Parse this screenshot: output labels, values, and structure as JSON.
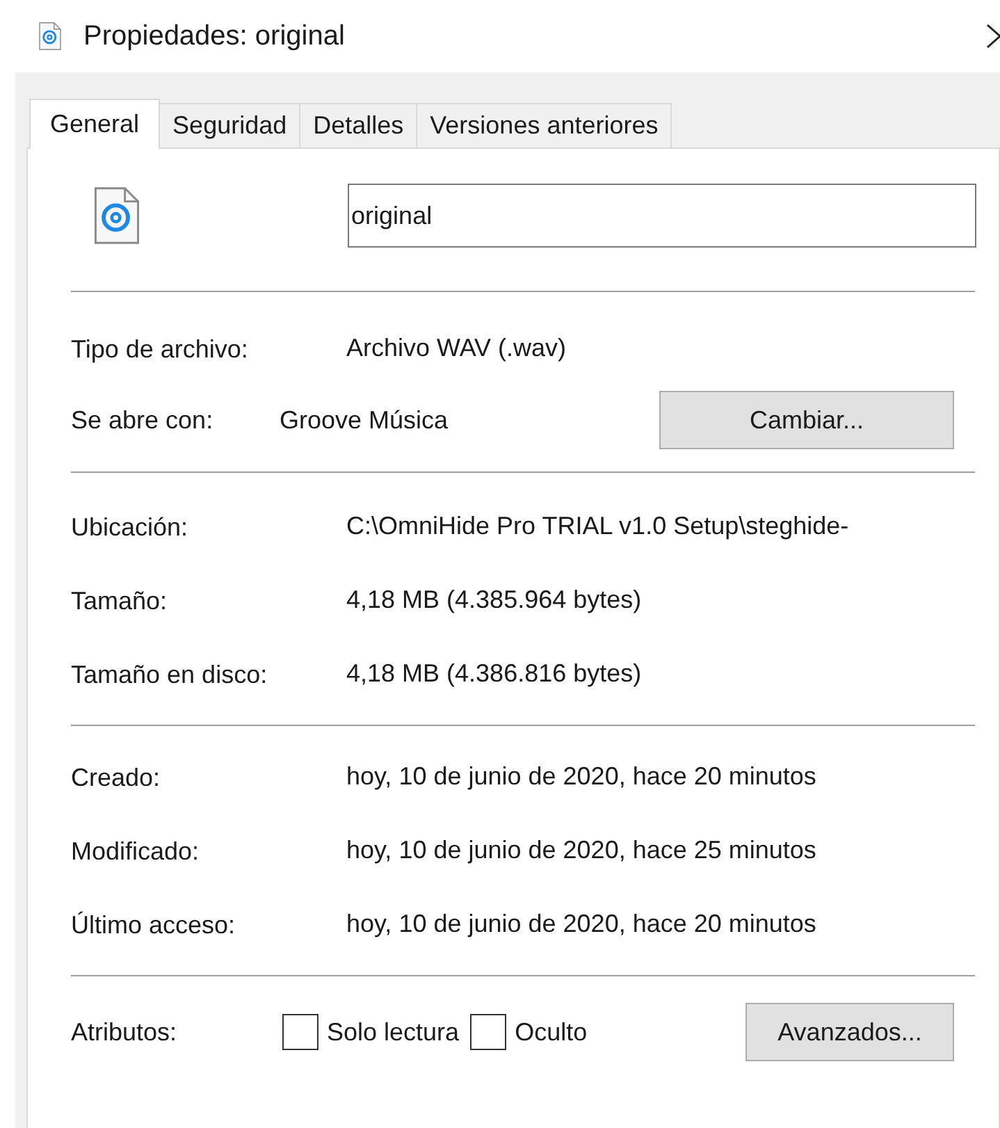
{
  "window": {
    "title": "Propiedades: original"
  },
  "tabs": [
    {
      "label": "General",
      "selected": true
    },
    {
      "label": "Seguridad",
      "selected": false
    },
    {
      "label": "Detalles",
      "selected": false
    },
    {
      "label": "Versiones anteriores",
      "selected": false
    }
  ],
  "name_field": {
    "value": "original"
  },
  "type_row": {
    "label": "Tipo de archivo:",
    "value": "Archivo WAV (.wav)"
  },
  "opens_with": {
    "label": "Se abre con:",
    "value": "Groove Música",
    "button": "Cambiar..."
  },
  "location_rows": [
    {
      "label": "Ubicación:",
      "value": "C:\\OmniHide Pro TRIAL v1.0 Setup\\steghide-"
    },
    {
      "label": "Tamaño:",
      "value": "4,18 MB (4.385.964 bytes)"
    },
    {
      "label": "Tamaño en disco:",
      "value": "4,18 MB (4.386.816 bytes)"
    }
  ],
  "date_rows": [
    {
      "label": "Creado:",
      "value": "hoy, 10 de junio de 2020, hace 20 minutos"
    },
    {
      "label": "Modificado:",
      "value": "hoy, 10 de junio de 2020, hace 25 minutos"
    },
    {
      "label": "Último acceso:",
      "value": "hoy, 10 de junio de 2020, hace 20 minutos"
    }
  ],
  "attributes": {
    "label": "Atributos:",
    "checkboxes": [
      {
        "label": "Solo lectura",
        "checked": false
      },
      {
        "label": "Oculto",
        "checked": false
      }
    ],
    "button": "Avanzados..."
  }
}
